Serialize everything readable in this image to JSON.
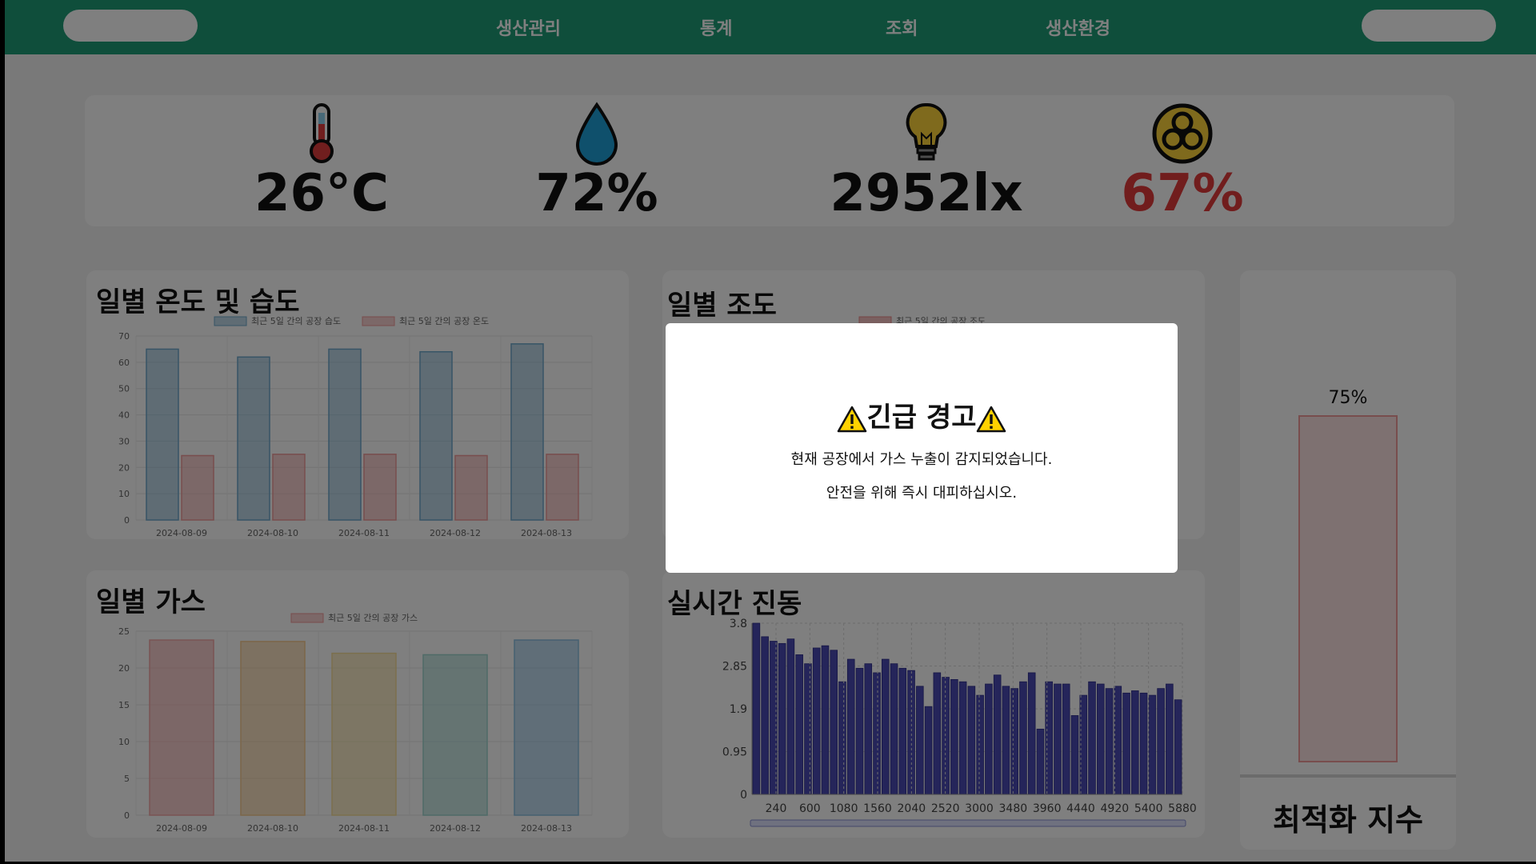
{
  "nav": {
    "menu": [
      "생산관리",
      "통계",
      "조회",
      "생산환경"
    ]
  },
  "sensors": {
    "temperature": {
      "icon": "thermometer-icon",
      "value": "26°C"
    },
    "humidity": {
      "icon": "water-drop-icon",
      "value": "72%"
    },
    "illuminance": {
      "icon": "light-bulb-icon",
      "value": "2952lx"
    },
    "gas": {
      "icon": "biohazard-icon",
      "value": "67%",
      "color": "#e23b3b"
    }
  },
  "colors": {
    "nav": "#1f9d77",
    "humidity_series": "#6fa8cc",
    "temperature_series": "#f09a9a",
    "vibration_series": "#4b4bb5",
    "alert": "#e23b3b"
  },
  "panels": {
    "temp_humidity_title": "일별 온도 및 습도",
    "illuminance_title": "일별 조도",
    "illuminance_legend": "최근 5일 간의 공장 조도",
    "gas_title": "일별 가스",
    "vibration_title": "실시간 진동",
    "optimization_label": "최적화 지수"
  },
  "modal": {
    "title": "긴급 경고",
    "line1": "현재 공장에서 가스 누출이 감지되었습니다.",
    "line2": "안전을 위해 즉시 대피하십시오."
  },
  "chart_data": [
    {
      "id": "temp_humidity",
      "type": "bar",
      "categories": [
        "2024-08-09",
        "2024-08-10",
        "2024-08-11",
        "2024-08-12",
        "2024-08-13"
      ],
      "series": [
        {
          "name": "최근 5일 간의 공장 습도",
          "values": [
            65,
            62,
            65,
            64,
            67
          ],
          "color": "#6fa8cc"
        },
        {
          "name": "최근 5일 간의 공장 온도",
          "values": [
            24.5,
            25,
            25,
            24.5,
            25
          ],
          "color": "#f09a9a"
        }
      ],
      "ylim": [
        0,
        70
      ],
      "yticks": [
        0,
        10,
        20,
        30,
        40,
        50,
        60,
        70
      ],
      "legend": "top"
    },
    {
      "id": "gas",
      "type": "bar",
      "categories": [
        "2024-08-09",
        "2024-08-10",
        "2024-08-11",
        "2024-08-12",
        "2024-08-13"
      ],
      "series": [
        {
          "name": "최근 5일 간의 공장 가스",
          "values": [
            23.8,
            23.6,
            22,
            21.8,
            23.8
          ]
        }
      ],
      "bar_colors": [
        "#f4a7a7",
        "#f8cc92",
        "#f6df9a",
        "#9fd6cf",
        "#8cc0e3"
      ],
      "ylim": [
        0,
        25
      ],
      "yticks": [
        0,
        5,
        10,
        15,
        20,
        25
      ],
      "legend": "top"
    },
    {
      "id": "vibration",
      "type": "bar",
      "x_ticks": [
        240,
        600,
        1080,
        1560,
        2040,
        2520,
        3000,
        3480,
        3960,
        4440,
        4920,
        5400,
        5880
      ],
      "values": [
        3.8,
        3.5,
        3.4,
        3.35,
        3.45,
        3.1,
        2.9,
        3.25,
        3.3,
        3.2,
        2.5,
        3.0,
        2.8,
        2.9,
        2.7,
        3.0,
        2.9,
        2.8,
        2.75,
        2.4,
        1.95,
        2.7,
        2.6,
        2.55,
        2.5,
        2.4,
        2.2,
        2.45,
        2.65,
        2.4,
        2.35,
        2.5,
        2.7,
        1.45,
        2.5,
        2.45,
        2.45,
        1.75,
        2.2,
        2.5,
        2.45,
        2.35,
        2.4,
        2.25,
        2.3,
        2.25,
        2.2,
        2.35,
        2.45,
        2.1
      ],
      "ylim": [
        0,
        3.8
      ],
      "yticks": [
        0,
        0.95,
        1.9,
        2.85,
        3.8
      ],
      "grid": true
    },
    {
      "id": "optimization",
      "type": "bar",
      "values": [
        75
      ],
      "value_label": "75%",
      "ylim": [
        0,
        100
      ]
    }
  ]
}
